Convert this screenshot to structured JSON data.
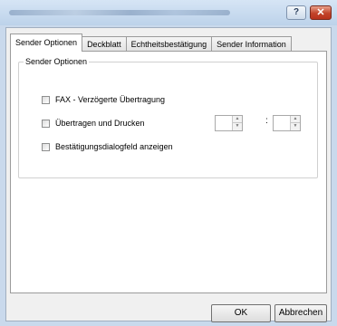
{
  "window": {
    "help_label": "?",
    "close_label": "✕"
  },
  "tabs": [
    {
      "label": "Sender Optionen"
    },
    {
      "label": "Deckblatt"
    },
    {
      "label": "Echtheitsbestätigung"
    },
    {
      "label": "Sender Information"
    }
  ],
  "group": {
    "title": "Sender Optionen",
    "options": [
      {
        "label": "FAX - Verzögerte Übertragung",
        "checked": false
      },
      {
        "label": "Übertragen und Drucken",
        "checked": false
      },
      {
        "label": "Bestätigungsdialogfeld anzeigen",
        "checked": false
      }
    ],
    "time_separator": ":"
  },
  "buttons": {
    "ok": "OK",
    "cancel": "Abbrechen"
  }
}
